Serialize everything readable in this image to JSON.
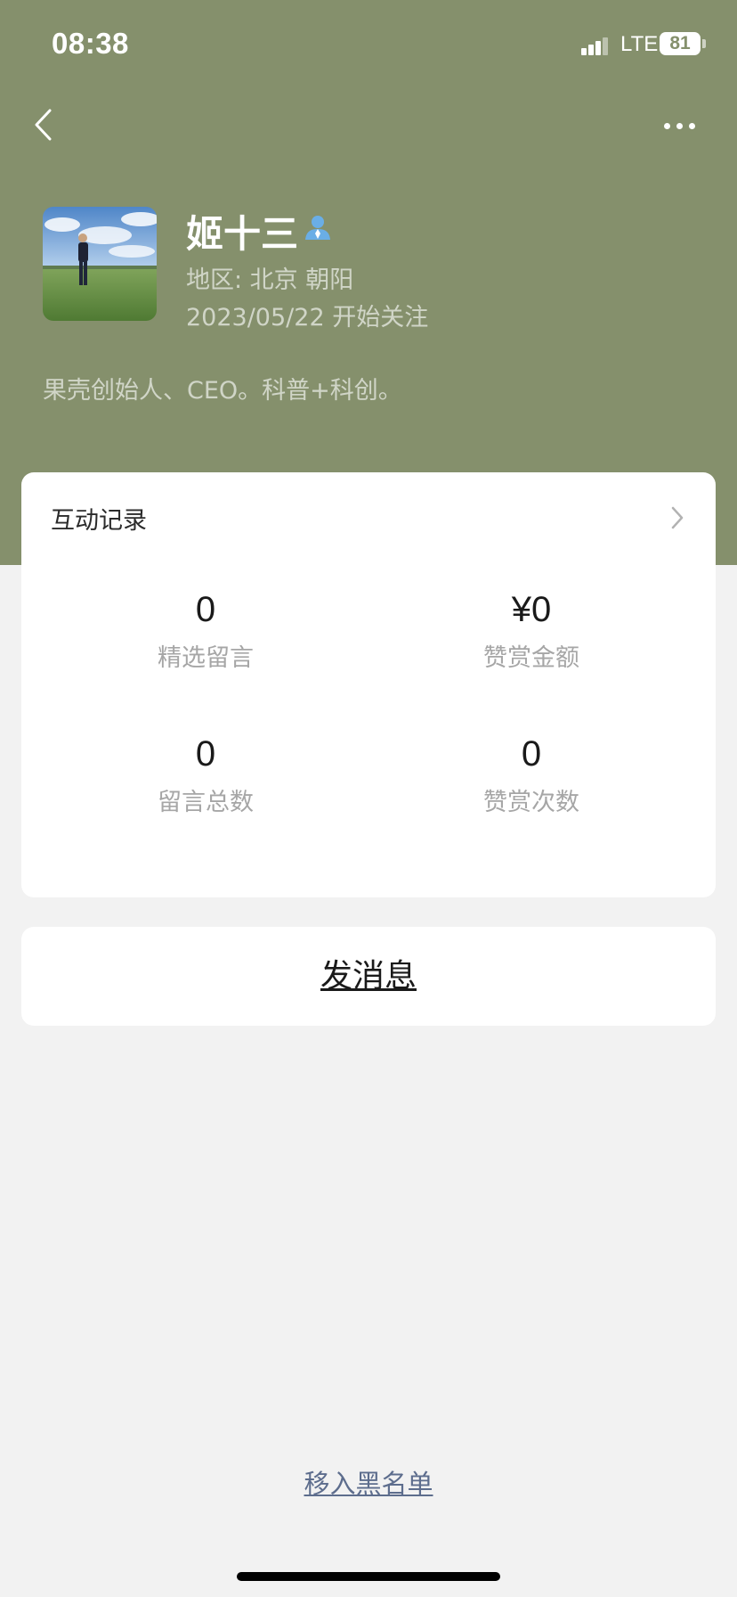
{
  "status_bar": {
    "time": "08:38",
    "network": "LTE",
    "battery": "81"
  },
  "icons": {
    "back": "chevron-left-icon",
    "more": "ellipsis-icon",
    "verified": "person-badge-icon",
    "card_chevron": "chevron-right-icon"
  },
  "profile": {
    "name": "姬十三",
    "region": "地区: 北京 朝阳",
    "follow_date": "2023/05/22 开始关注",
    "bio": "果壳创始人、CEO。科普+科创。"
  },
  "interaction": {
    "title": "互动记录",
    "stats": [
      {
        "value": "0",
        "label": "精选留言"
      },
      {
        "value": "¥0",
        "label": "赞赏金额"
      },
      {
        "value": "0",
        "label": "留言总数"
      },
      {
        "value": "0",
        "label": "赞赏次数"
      }
    ]
  },
  "actions": {
    "send_message": "发消息",
    "blacklist": "移入黑名单"
  },
  "colors": {
    "header": "#85906c",
    "page_bg": "#f2f2f2",
    "card": "#ffffff",
    "link": "#5d6d8d",
    "verified": "#6aaee6"
  }
}
